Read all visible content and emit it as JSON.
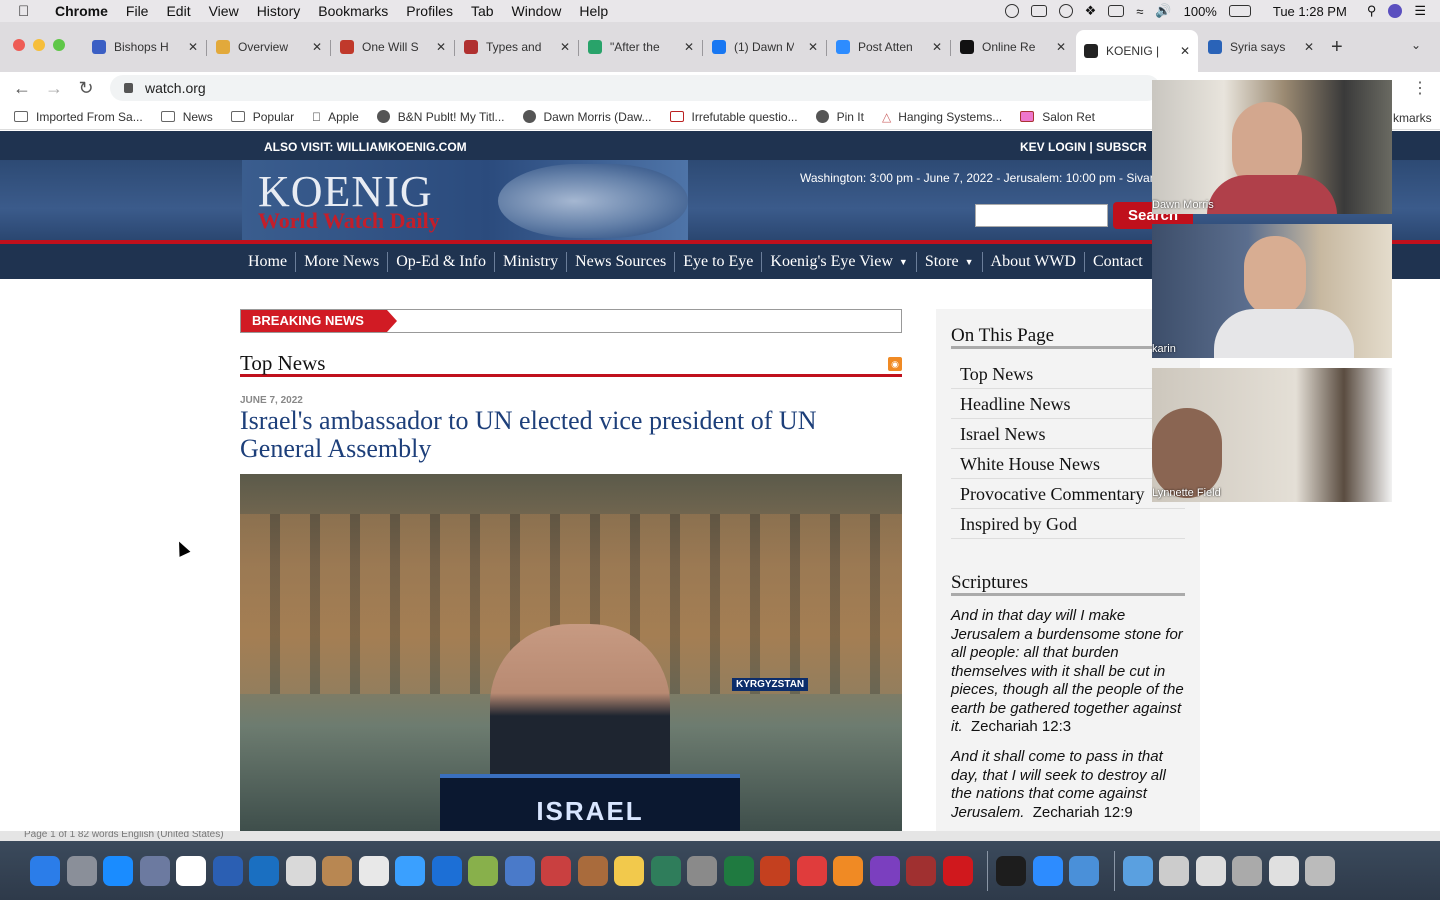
{
  "menubar": {
    "app": "Chrome",
    "items": [
      "File",
      "Edit",
      "View",
      "History",
      "Bookmarks",
      "Profiles",
      "Tab",
      "Window",
      "Help"
    ],
    "battery": "100%",
    "clock": "Tue 1:28 PM"
  },
  "tabs": [
    {
      "label": "Bishops H",
      "color": "#3b5fc4"
    },
    {
      "label": "Overview",
      "color": "#e2a93b"
    },
    {
      "label": "One Will S",
      "color": "#c0392b"
    },
    {
      "label": "Types and",
      "color": "#b03030"
    },
    {
      "label": "\"After the",
      "color": "#29a36a"
    },
    {
      "label": "(1) Dawn M",
      "color": "#1877f2"
    },
    {
      "label": "Post Atten",
      "color": "#2d8cff"
    },
    {
      "label": "Online Re",
      "color": "#111111"
    },
    {
      "label": "KOENIG |",
      "color": "#222222",
      "active": true
    },
    {
      "label": "Syria says",
      "color": "#2a63b8"
    }
  ],
  "url": "watch.org",
  "bookmarks": [
    "Imported From Sa...",
    "News",
    "Popular",
    "Apple",
    "B&N Publt! My Titl...",
    "Dawn Morris (Daw...",
    "Irrefutable questio...",
    "Pin It",
    "Hanging Systems...",
    "Salon Ret"
  ],
  "bookmarks_tail": "kmarks",
  "site": {
    "also_visit": "ALSO VISIT: WILLIAMKOENIG.COM",
    "login": "KEV LOGIN  |  SUBSCR",
    "logo_top": "KOENIG",
    "logo_bottom": "World Watch Daily",
    "datetime": "Washington: 3:00 pm - June 7, 2022 - Jerusalem: 10:00 pm - Sivan",
    "search_button": "Search",
    "nav": [
      {
        "label": "Home"
      },
      {
        "label": "More News"
      },
      {
        "label": "Op-Ed & Info"
      },
      {
        "label": "Ministry"
      },
      {
        "label": "News Sources"
      },
      {
        "label": "Eye to Eye"
      },
      {
        "label": "Koenig's Eye View",
        "dropdown": true
      },
      {
        "label": "Store",
        "dropdown": true
      },
      {
        "label": "About WWD"
      },
      {
        "label": "Contact"
      }
    ],
    "breaking_label": "BREAKING NEWS",
    "top_news_heading": "Top News",
    "article": {
      "date": "JUNE 7, 2022",
      "title": "Israel's ambassador to UN elected vice president of UN General Assembly",
      "photo_desk_text": "ISRAEL",
      "photo_tag": "KYRGYZSTAN"
    },
    "on_this_page_heading": "On This Page",
    "on_this_page": [
      "Top News",
      "Headline News",
      "Israel News",
      "White House News",
      "Provocative Commentary",
      "Inspired by God"
    ],
    "scriptures_heading": "Scriptures",
    "scriptures": [
      {
        "text": "And in that day will I make Jerusalem a burdensome stone for all people: all that burden themselves with it shall be cut in pieces, though all the people of the earth be gathered together against it.",
        "ref": "Zechariah 12:3"
      },
      {
        "text": "And it shall come to pass in that day, that I will seek to destroy all the nations that come against Jerusalem.",
        "ref": "Zechariah 12:9"
      }
    ]
  },
  "video_participants": [
    "Dawn Morris",
    "karin",
    "Lynnette Field"
  ],
  "word_status": "Page 1 of 1    82 words         English (United States)",
  "dock_colors": [
    "#2b7de9",
    "#8a8f99",
    "#1a8cff",
    "#6c7aa0",
    "#ffffff",
    "#2b5fb3",
    "#1a6fc1",
    "#d9d9d9",
    "#b88752",
    "#e8e8e8",
    "#3aa0ff",
    "#1c6fd6",
    "#88b04b",
    "#4a7ac9",
    "#c94040",
    "#a96b3c",
    "#f2c94c",
    "#2f7d5b",
    "#8a8a8a",
    "#1f7a40",
    "#c4401f",
    "#e03c3c",
    "#f08a24",
    "#7b3fbf",
    "#a03030",
    "#d0181d",
    "#1d1d1d",
    "#2d8cff",
    "#4a90d9",
    "#5aa0e0",
    "#cccccc",
    "#dddddd",
    "#aaaaaa",
    "#e0e0e0",
    "#bbbbbb"
  ]
}
